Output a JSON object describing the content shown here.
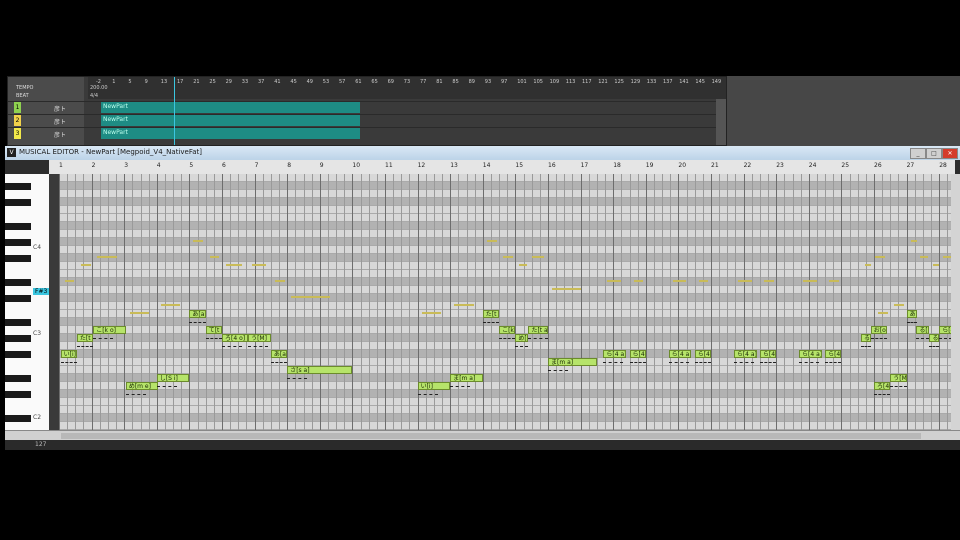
{
  "tracks_panel": {
    "tempo_label": "TEMPO",
    "tempo_value": "200.00",
    "beat_label": "BEAT",
    "beat_value": "4/4",
    "ruler": [
      "-2",
      "1",
      "5",
      "9",
      "13",
      "17",
      "21",
      "25",
      "29",
      "33",
      "37",
      "41",
      "45",
      "49",
      "53",
      "57",
      "61",
      "65",
      "69",
      "73",
      "77",
      "81",
      "85",
      "89",
      "93",
      "97",
      "101",
      "105",
      "109",
      "113",
      "117",
      "121",
      "125",
      "129",
      "133",
      "137",
      "141",
      "145",
      "149"
    ],
    "tracks": [
      {
        "number": "1",
        "label": "彦ト",
        "part": "NewPart",
        "color": "#8fd14f"
      },
      {
        "number": "2",
        "label": "彦ト",
        "part": "NewPart",
        "color": "#f1d14a"
      },
      {
        "number": "3",
        "label": "彦ト",
        "part": "NewPart",
        "color": "#f1e84a"
      }
    ]
  },
  "editor": {
    "title": "MUSICAL EDITOR - NewPart [Megpoid_V4_NativeFat]",
    "minimize": "_",
    "restore": "□",
    "close": "✕",
    "ruler": [
      "1",
      "2",
      "3",
      "4",
      "5",
      "6",
      "7",
      "8",
      "9",
      "10",
      "11",
      "12",
      "13",
      "14",
      "15",
      "16",
      "17",
      "18",
      "19",
      "20",
      "21",
      "22",
      "23",
      "24",
      "25",
      "26",
      "27",
      "28"
    ],
    "octave_labels": {
      "c4": "C4",
      "hl": "F#3",
      "c3": "C3",
      "c2": "C2"
    },
    "bottom_value": "127",
    "notes": [
      {
        "lyric": "い[i]",
        "row": 22,
        "start": 0.05,
        "len": 0.5
      },
      {
        "lyric": "た[t a]",
        "row": 20,
        "start": 0.55,
        "len": 0.5
      },
      {
        "lyric": "こ[k o]",
        "row": 19,
        "start": 1.05,
        "len": 1.0
      },
      {
        "lyric": "め[m e]",
        "row": 26,
        "start": 2.05,
        "len": 1.0
      },
      {
        "lyric": "し[S i]",
        "row": 25,
        "start": 3.0,
        "len": 1.0
      },
      {
        "lyric": "あ[a]",
        "row": 17,
        "start": 4.0,
        "len": 0.5
      },
      {
        "lyric": "て[t e]",
        "row": 19,
        "start": 4.5,
        "len": 0.5
      },
      {
        "lyric": "ろ[4 o]",
        "row": 20,
        "start": 5.0,
        "len": 0.8
      },
      {
        "lyric": "う[M]",
        "row": 20,
        "start": 5.8,
        "len": 0.7
      },
      {
        "lyric": "あ[a]",
        "row": 22,
        "start": 6.5,
        "len": 0.5
      },
      {
        "lyric": "さ[s a]",
        "row": 24,
        "start": 7.0,
        "len": 2.0
      },
      {
        "lyric": "い[i]",
        "row": 26,
        "start": 11.0,
        "len": 1.0
      },
      {
        "lyric": "ま[m a]",
        "row": 25,
        "start": 12.0,
        "len": 1.0
      },
      {
        "lyric": "た[t a]",
        "row": 17,
        "start": 13.0,
        "len": 0.5
      },
      {
        "lyric": "こ[k o]",
        "row": 19,
        "start": 13.5,
        "len": 0.5
      },
      {
        "lyric": "め[m e]",
        "row": 20,
        "start": 14.0,
        "len": 0.4
      },
      {
        "lyric": "た[t a]",
        "row": 19,
        "start": 14.4,
        "len": 0.6
      },
      {
        "lyric": "ま[m a]",
        "row": 23,
        "start": 15.0,
        "len": 1.5
      },
      {
        "lyric": "ら[4 a]",
        "row": 22,
        "start": 16.7,
        "len": 0.7
      },
      {
        "lyric": "ら[4 a]",
        "row": 22,
        "start": 17.5,
        "len": 0.5
      },
      {
        "lyric": "ら[4 a]",
        "row": 22,
        "start": 18.7,
        "len": 0.7
      },
      {
        "lyric": "ら[4 a]",
        "row": 22,
        "start": 19.5,
        "len": 0.5
      },
      {
        "lyric": "ら[4 a]",
        "row": 22,
        "start": 20.7,
        "len": 0.7
      },
      {
        "lyric": "ら[4 a]",
        "row": 22,
        "start": 21.5,
        "len": 0.5
      },
      {
        "lyric": "ら[4 a]",
        "row": 22,
        "start": 22.7,
        "len": 0.7
      },
      {
        "lyric": "ら[4 a]",
        "row": 22,
        "start": 23.5,
        "len": 0.5
      },
      {
        "lyric": "ろ[4 o]",
        "row": 26,
        "start": 25.0,
        "len": 0.5
      },
      {
        "lyric": "う[M]",
        "row": 25,
        "start": 25.5,
        "len": 0.5
      },
      {
        "lyric": "る[4 M]",
        "row": 20,
        "start": 24.6,
        "len": 0.3
      },
      {
        "lyric": "お[o]",
        "row": 19,
        "start": 24.9,
        "len": 0.5
      },
      {
        "lyric": "あ[a]",
        "row": 17,
        "start": 26.0,
        "len": 0.3
      },
      {
        "lyric": "る[4 M]",
        "row": 19,
        "start": 26.3,
        "len": 0.4
      },
      {
        "lyric": "る[4 M]",
        "row": 20,
        "start": 26.7,
        "len": 0.3
      },
      {
        "lyric": "ら[4 a]",
        "row": 19,
        "start": 27.0,
        "len": 0.4
      },
      {
        "lyric": "お[o]",
        "row": 20,
        "start": 27.4,
        "len": 0.3
      }
    ]
  }
}
